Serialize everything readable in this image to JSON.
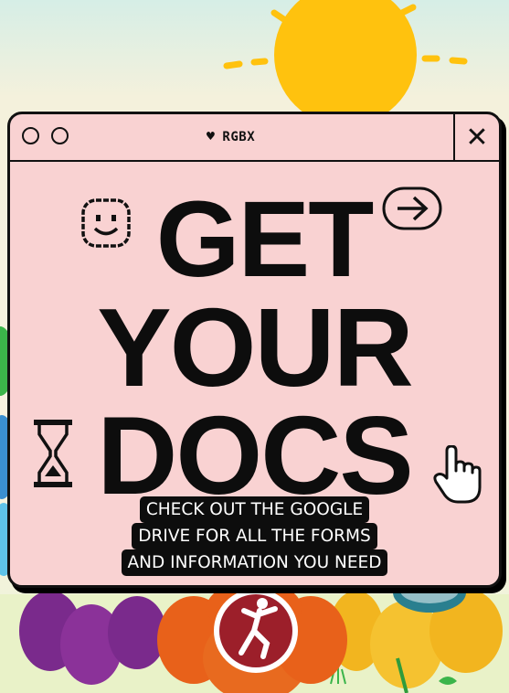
{
  "window": {
    "brand": "RGBX",
    "brand_icon": "heart-icon",
    "close_label": "✕",
    "controls": [
      "circle-button",
      "circle-button"
    ]
  },
  "headline": {
    "line1": "GET",
    "line2": "YOUR",
    "line3": "DOCS"
  },
  "caption": {
    "line1": "CHECK OUT THE GOOGLE",
    "line2": "DRIVE FOR ALL THE FORMS",
    "line3": "AND INFORMATION YOU NEED"
  },
  "icons": [
    "smiley-icon",
    "arrow-right-icon",
    "hourglass-icon",
    "hand-pointer-icon",
    "sun-icon",
    "flower-icon",
    "dancer-logo-icon"
  ],
  "colors": {
    "window_bg": "#f9d2d2",
    "ink": "#0d0d0d",
    "sun": "#ffc20e",
    "flower_orange": "#e8611a",
    "flower_purple": "#7a2a8c",
    "flower_yellow": "#f2b51f",
    "flower_green": "#3bb54a",
    "flower_blue": "#3a8fd1",
    "logo_red": "#9c1f2a"
  }
}
